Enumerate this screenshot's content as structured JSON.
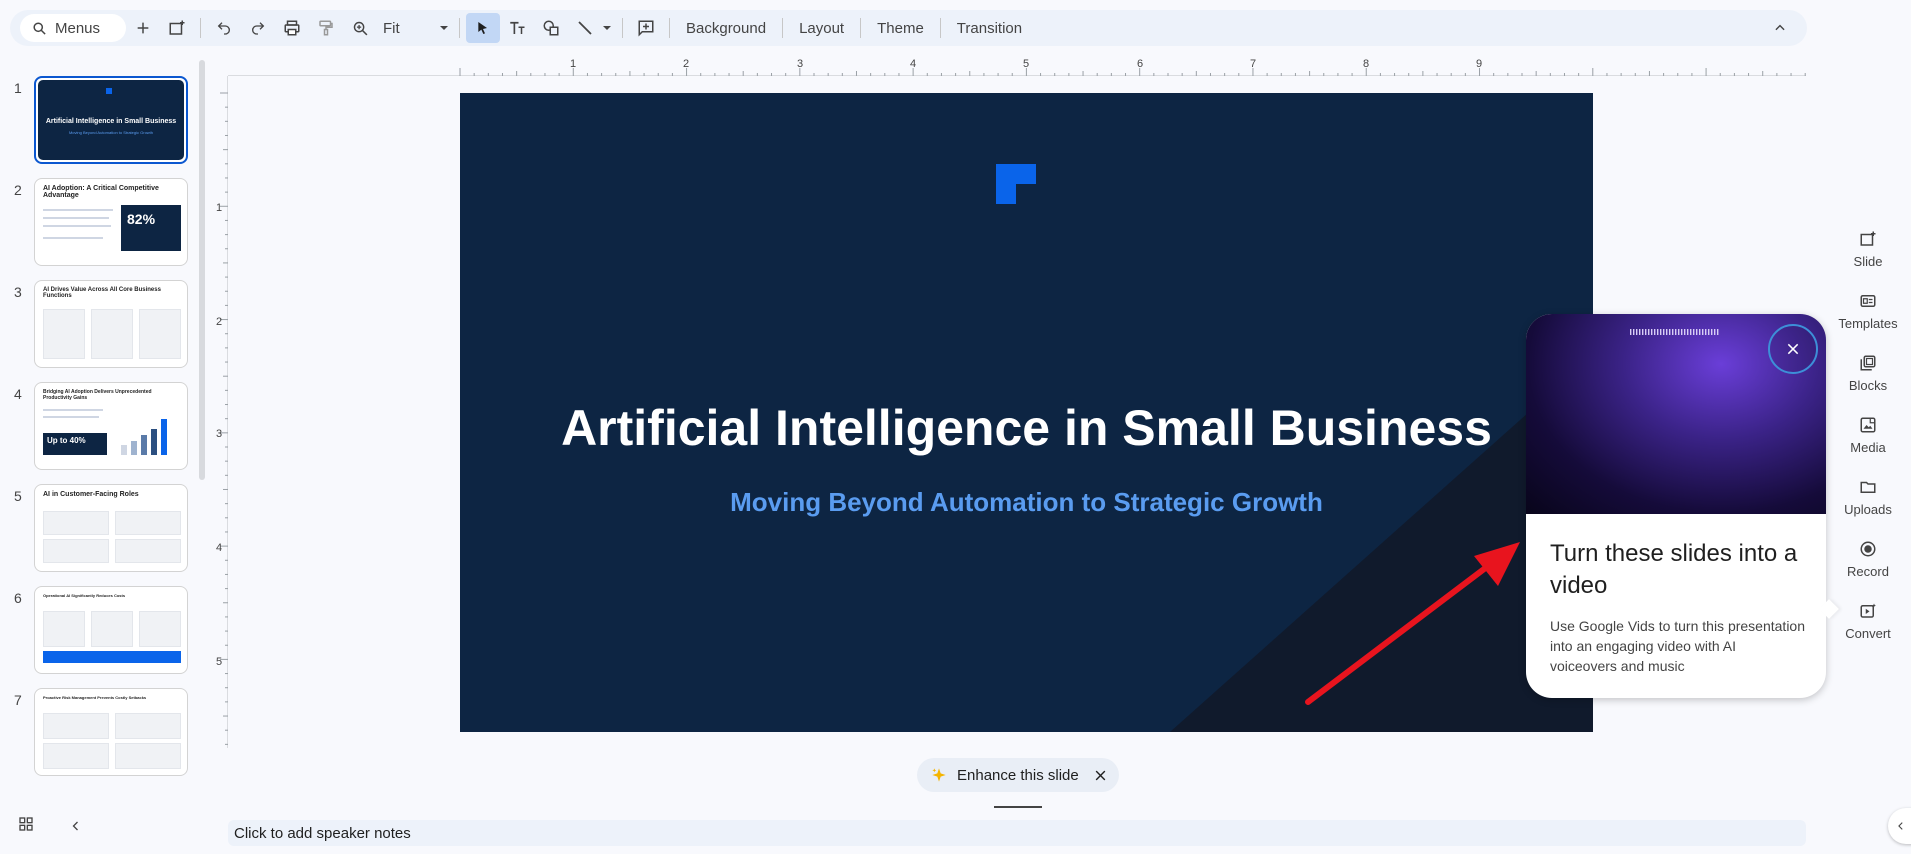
{
  "toolbar": {
    "search_label": "Menus",
    "zoom_value": "Fit",
    "background_label": "Background",
    "layout_label": "Layout",
    "theme_label": "Theme",
    "transition_label": "Transition"
  },
  "thumbnails": [
    {
      "number": "1",
      "title": "Artificial Intelligence in Small Business",
      "subtitle": "Moving Beyond Automation to Strategic Growth"
    },
    {
      "number": "2",
      "title": "AI Adoption: A Critical Competitive Advantage",
      "stat": "82%"
    },
    {
      "number": "3",
      "title": "AI Drives Value Across All Core Business Functions"
    },
    {
      "number": "4",
      "title": "Bridging AI Adoption Delivers Unprecedented Productivity Gains",
      "stat": "Up to 40%"
    },
    {
      "number": "5",
      "title": "AI in Customer-Facing Roles"
    },
    {
      "number": "6",
      "title": "Operational AI Significantly Reduces Costs"
    },
    {
      "number": "7",
      "title": "Proactive Risk Management Prevents Costly Setbacks"
    }
  ],
  "ruler": {
    "h_ticks": [
      "1",
      "2",
      "3",
      "4",
      "5",
      "6",
      "7",
      "8",
      "9"
    ],
    "v_ticks": [
      "1",
      "2",
      "3",
      "4",
      "5"
    ]
  },
  "slide": {
    "title": "Artificial Intelligence in Small Business",
    "subtitle": "Moving Beyond Automation to Strategic Growth",
    "colors": {
      "background": "#0d2543",
      "accent": "#0a64ea",
      "subtitle": "#5a9cf0"
    }
  },
  "right_panel": [
    {
      "label": "Slide",
      "icon": "add-slide-icon"
    },
    {
      "label": "Templates",
      "icon": "templates-icon"
    },
    {
      "label": "Blocks",
      "icon": "blocks-icon"
    },
    {
      "label": "Media",
      "icon": "media-icon"
    },
    {
      "label": "Uploads",
      "icon": "folder-icon"
    },
    {
      "label": "Record",
      "icon": "record-icon"
    },
    {
      "label": "Convert",
      "icon": "convert-icon"
    }
  ],
  "popup": {
    "title": "Turn these slides into a video",
    "body": "Use Google Vids to turn this presentation into an engaging video with AI voiceovers and music"
  },
  "enhance": {
    "label": "Enhance this slide"
  },
  "notes": {
    "placeholder": "Click to add speaker notes"
  }
}
